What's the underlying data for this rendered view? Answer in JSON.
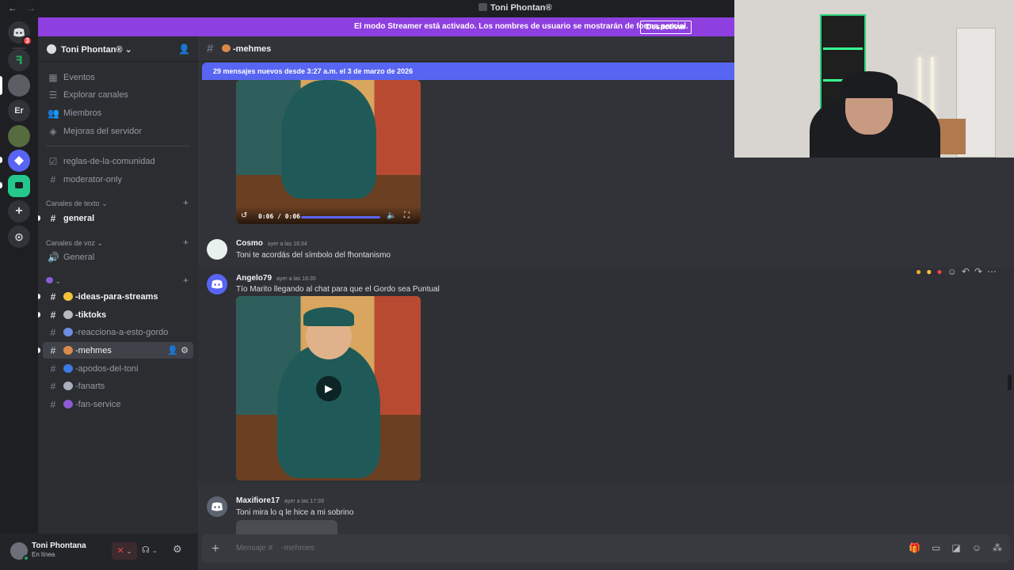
{
  "window": {
    "title": "Toni Phontan®",
    "back": "←",
    "forward": "→"
  },
  "streamer_banner": {
    "text": "El modo Streamer está activado. Los nombres de usuario se mostrarán de forma parcial.",
    "button": "Desactivar"
  },
  "guilds": {
    "home_badge": "3",
    "items": [
      {
        "name": "discord-home",
        "label": ""
      },
      {
        "name": "server-f",
        "label": "ꟻ"
      },
      {
        "name": "server-avatar-1",
        "label": ""
      },
      {
        "name": "server-er",
        "label": "Er"
      },
      {
        "name": "server-avatar-2",
        "label": ""
      },
      {
        "name": "server-diamond",
        "label": ""
      },
      {
        "name": "server-tiktok",
        "label": ""
      },
      {
        "name": "add-server",
        "label": "+"
      },
      {
        "name": "explore",
        "label": "⊙"
      }
    ]
  },
  "server": {
    "name": "Toni Phontan®",
    "chevron": "⌄"
  },
  "sidebar": {
    "nav": [
      {
        "label": "Eventos",
        "icon": "calendar-icon"
      },
      {
        "label": "Explorar canales",
        "icon": "channels-icon"
      },
      {
        "label": "Miembros",
        "icon": "members-icon"
      },
      {
        "label": "Mejoras del servidor",
        "icon": "boost-icon"
      }
    ],
    "pinned": [
      {
        "label": "reglas-de-la-comunidad"
      },
      {
        "label": "moderator-only"
      }
    ],
    "category_text": "Canales de texto",
    "text_channels": [
      {
        "label": "general"
      }
    ],
    "category_voice": "Canales de voz",
    "voice_channels": [
      {
        "label": "General"
      }
    ],
    "category_custom": "",
    "custom_channels": [
      {
        "label": "-ideas-para-streams",
        "emoji_color": "#f5c33b"
      },
      {
        "label": "-tiktoks",
        "emoji_color": "#b5bac1"
      },
      {
        "label": "-reacciona-a-esto-gordo",
        "emoji_color": "#6c8de0"
      },
      {
        "label": "-mehmes",
        "emoji_color": "#d98a4a"
      },
      {
        "label": "-apodos-del-toni",
        "emoji_color": "#3b7be0"
      },
      {
        "label": "-fanarts",
        "emoji_color": "#aab0bc"
      },
      {
        "label": "-fan-service",
        "emoji_color": "#8e5bd6"
      }
    ]
  },
  "user": {
    "name": "Toni Phontana",
    "status": "En línea"
  },
  "channel": {
    "name": "-mehmes"
  },
  "new_messages_bar": "29 mensajes nuevos desde 3:27 a.m. el 3 de marzo de 2026",
  "video_top": {
    "time": "0:06 / 0:06"
  },
  "messages": [
    {
      "author": "Cosmo",
      "time": "ayer a las 16:34",
      "text": "Toni te acordás del símbolo del fhontanismo",
      "avatar_color": "#e8f1ee"
    },
    {
      "author": "Angelo79",
      "time": "ayer a las 16:35",
      "text": "Tío Marito llegando al chat para que el Gordo sea Puntual",
      "avatar_color": "#5865f2"
    },
    {
      "author": "Maxifiore17",
      "time": "ayer a las 17:39",
      "text": "Toni mira lo q le hice a mi sobrino",
      "avatar_color": "#5c6470"
    }
  ],
  "composer": {
    "placeholder": "Mensaje #    -mehmes"
  },
  "colors": {
    "accent": "#5865f2",
    "banner": "#8e3fe0",
    "online": "#23a55a",
    "danger": "#f23f43"
  }
}
